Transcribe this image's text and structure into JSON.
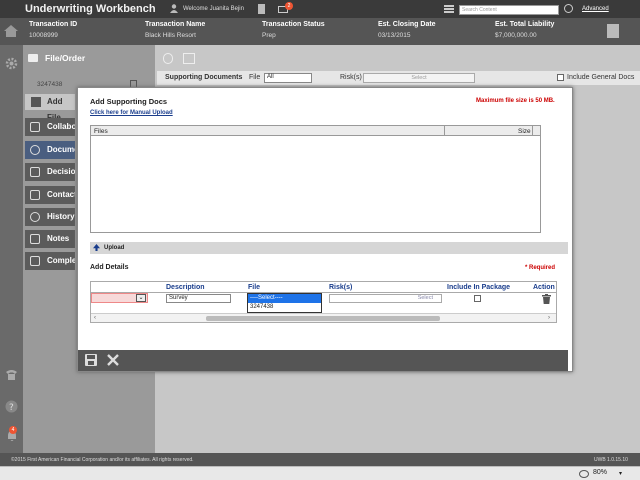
{
  "app": {
    "title": "Underwriting Workbench",
    "welcome": "Welcome Juanita Bejin",
    "notification_count": "2",
    "search_placeholder": "Search Content",
    "advanced_link": "Advanced"
  },
  "transaction": {
    "headers": [
      "Transaction ID",
      "Transaction Name",
      "Transaction Status",
      "Est. Closing Date",
      "Est. Total Liability"
    ],
    "values": [
      "10008999",
      "Black Hills Resort",
      "Prep",
      "03/13/2015",
      "$7,000,000.00"
    ]
  },
  "sidebar": {
    "header": "File/Order",
    "file_number": "3247438",
    "add_file": "Add File",
    "items": [
      "Collabo",
      "Docume",
      "Decisio",
      "Contact",
      "History",
      "Notes",
      "Comple"
    ],
    "active_index": 1,
    "rail_badge": "4"
  },
  "content": {
    "supporting_docs_label": "Supporting Documents",
    "file_label": "File",
    "file_value": "All",
    "risks_label": "Risk(s)",
    "risks_placeholder": "Select",
    "include_general": "Include General Docs"
  },
  "modal": {
    "title": "Add Supporting Docs",
    "max_size": "Maximum file size is 50 MB.",
    "manual_upload": "Click here for Manual Upload",
    "files_header": "Files",
    "size_header": "Size",
    "upload_label": "Upload",
    "add_details": "Add Details",
    "required": "* Required",
    "columns": [
      "Description",
      "File",
      "Risk(s)",
      "Include In Package",
      "Action"
    ],
    "row": {
      "description": "Survey",
      "file_select_placeholder": "----Select----",
      "file_option": "3247438",
      "risk_placeholder": "Select"
    }
  },
  "footer": {
    "copyright": "©2015 First American Financial Corporation and/or its affiliates. All rights reserved.",
    "version": "UWB 1.0.15.10"
  },
  "statusbar": {
    "zoom": "80%"
  },
  "colors": {
    "required": "#cc0000",
    "link": "#1a3d8c",
    "active_nav": "#4a5e80"
  }
}
